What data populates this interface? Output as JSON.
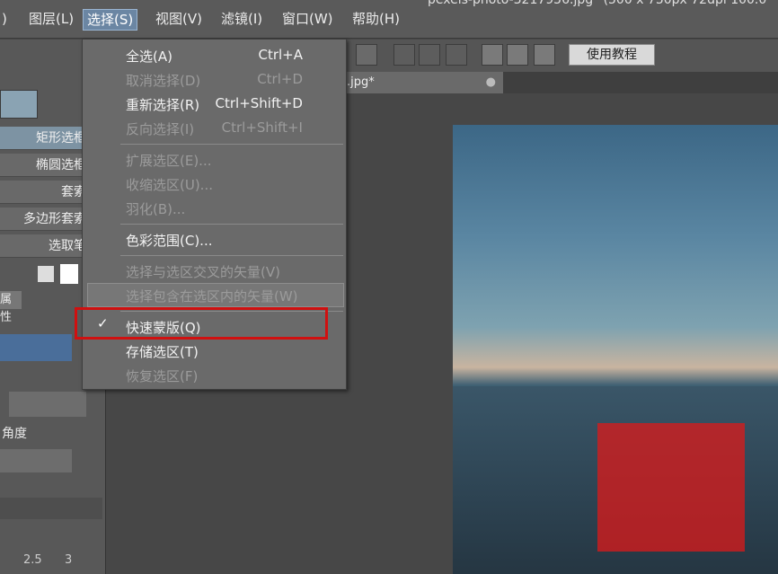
{
  "title": {
    "text": "pexels-photo-3217956.jpg* (500 x 750px 72dpi 100.0"
  },
  "menubar": {
    "items": [
      {
        "label": ")"
      },
      {
        "label": "图层(L)"
      },
      {
        "label": "选择(S)"
      },
      {
        "label": "视图(V)"
      },
      {
        "label": "滤镜(I)"
      },
      {
        "label": "窗口(W)"
      },
      {
        "label": "帮助(H)"
      }
    ]
  },
  "toolbar": {
    "tutorial_label": "使用教程"
  },
  "doc_tab": {
    "label": ".jpg*"
  },
  "left_panel": {
    "tools": [
      "矩形选框",
      "椭圆选框",
      "套索",
      "多边形套索",
      "选取笔"
    ],
    "properties_tab": "属性",
    "angle_label": "角度",
    "ruler_ticks": [
      "2.5",
      "3"
    ]
  },
  "menu": {
    "items": [
      {
        "label": "全选(A)",
        "shortcut": "Ctrl+A",
        "enabled": true
      },
      {
        "label": "取消选择(D)",
        "shortcut": "Ctrl+D",
        "enabled": false
      },
      {
        "label": "重新选择(R)",
        "shortcut": "Ctrl+Shift+D",
        "enabled": true
      },
      {
        "label": "反向选择(I)",
        "shortcut": "Ctrl+Shift+I",
        "enabled": false
      },
      {
        "label": "扩展选区(E)...",
        "shortcut": "",
        "enabled": false
      },
      {
        "label": "收缩选区(U)...",
        "shortcut": "",
        "enabled": false
      },
      {
        "label": "羽化(B)...",
        "shortcut": "",
        "enabled": false
      },
      {
        "label": "色彩范围(C)...",
        "shortcut": "",
        "enabled": true
      },
      {
        "label": "选择与选区交叉的矢量(V)",
        "shortcut": "",
        "enabled": false
      },
      {
        "label": "选择包含在选区内的矢量(W)",
        "shortcut": "",
        "enabled": false
      },
      {
        "label": "快速蒙版(Q)",
        "shortcut": "",
        "enabled": true,
        "checked": true
      },
      {
        "label": "存储选区(T)",
        "shortcut": "",
        "enabled": true
      },
      {
        "label": "恢复选区(F)",
        "shortcut": "",
        "enabled": false
      }
    ]
  },
  "colors": {
    "highlight_box": "#d01010",
    "active_menu": "#6b86a3",
    "quick_mask": "#dc1919"
  }
}
